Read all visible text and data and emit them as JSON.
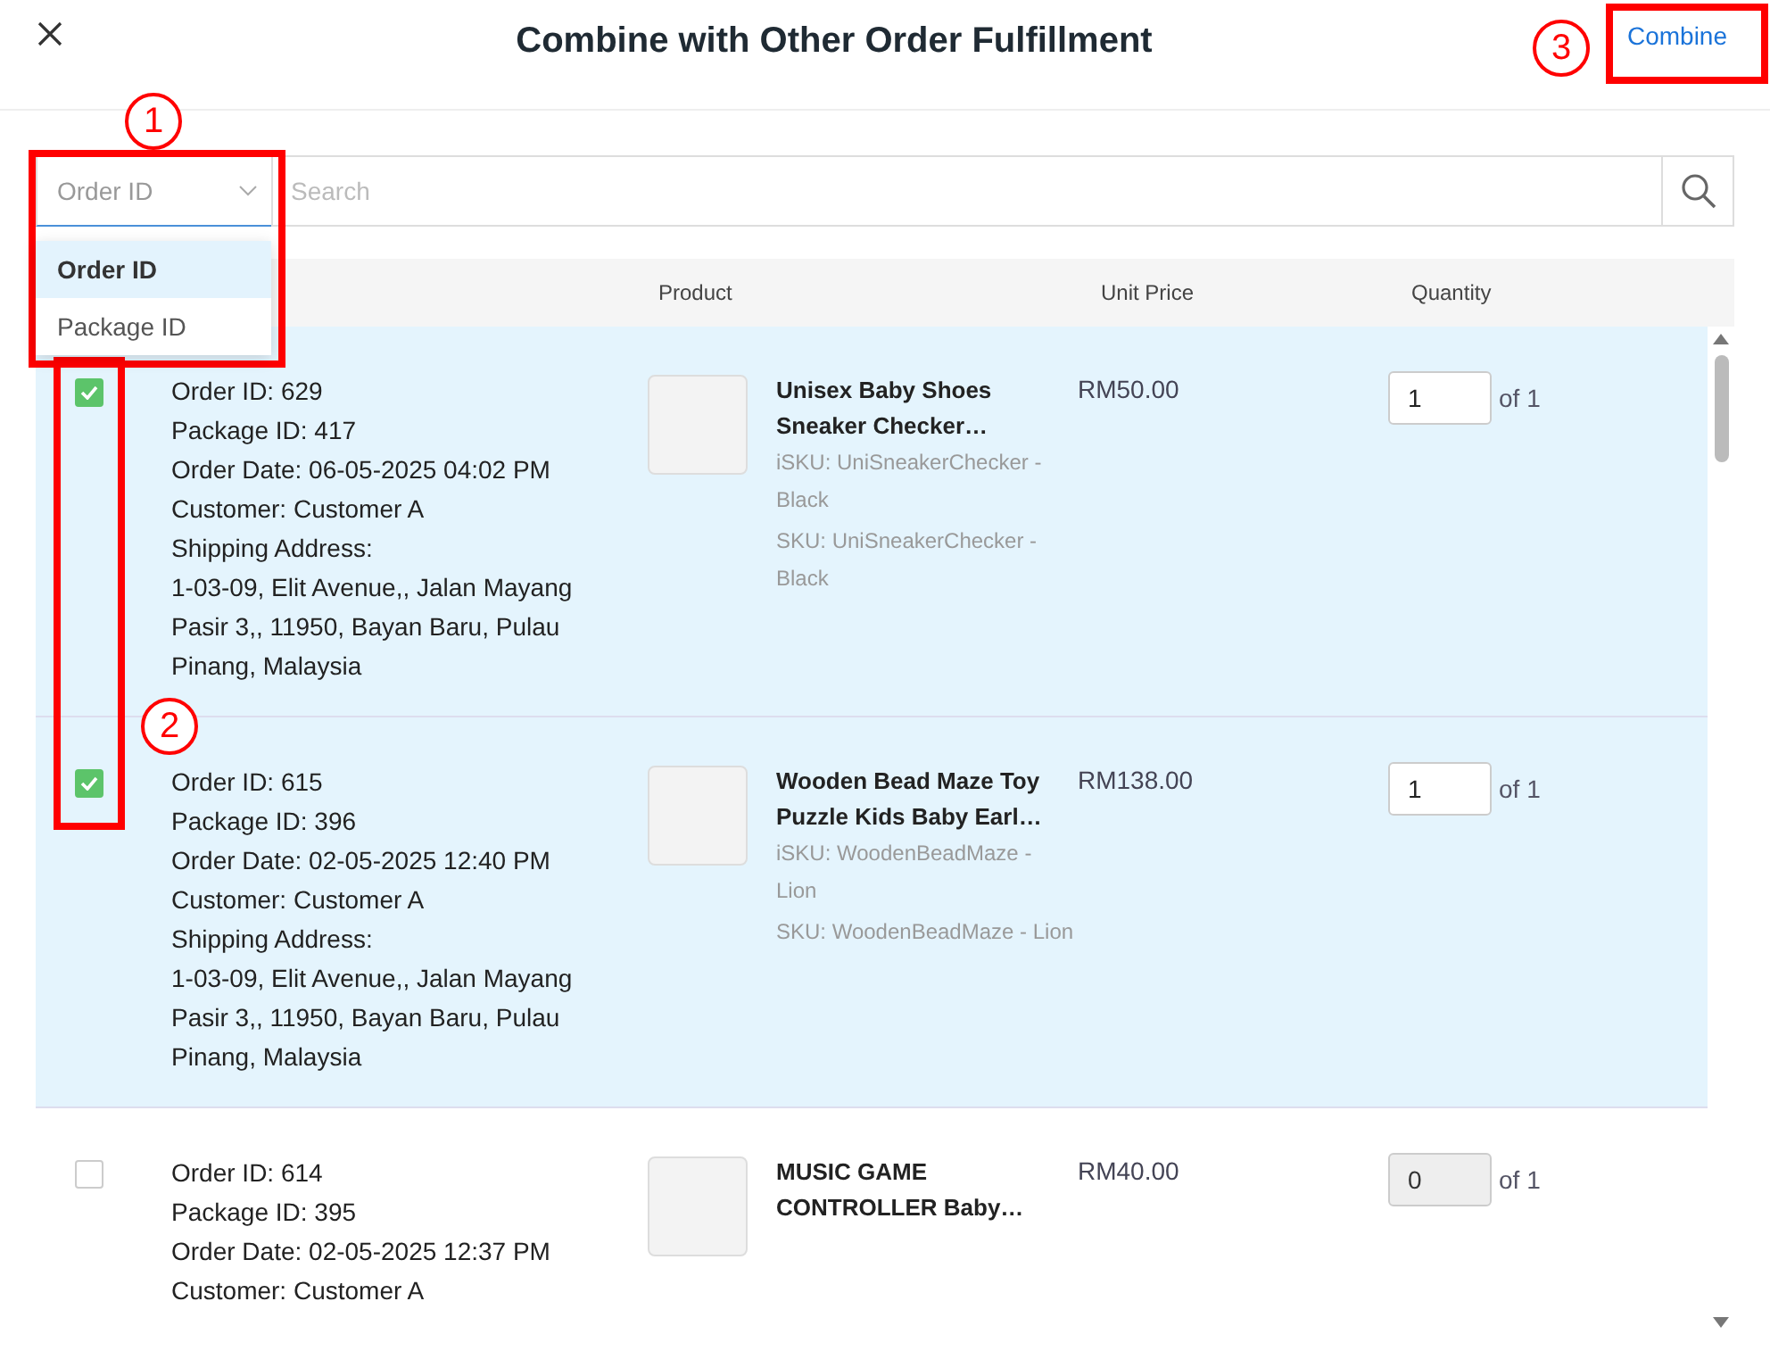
{
  "dialog": {
    "title": "Combine with Other Order Fulfillment",
    "primary_button": "Combine"
  },
  "search": {
    "filter": {
      "value": "Order ID",
      "expanded": true,
      "options": [
        {
          "label": "Order ID",
          "selected": true
        },
        {
          "label": "Package ID",
          "selected": false
        }
      ]
    },
    "placeholder": "Search"
  },
  "table": {
    "columns": [
      "Product",
      "Unit Price",
      "Quantity"
    ],
    "rows": [
      {
        "checked": true,
        "details": [
          "Order ID: 629",
          "Package ID: 417",
          "Order Date: 06-05-2025 04:02 PM",
          "Customer: Customer A",
          "Shipping Address:",
          "1-03-09, Elit Avenue,, Jalan Mayang Pasir 3,, 11950, Bayan Baru, Pulau Pinang, Malaysia"
        ],
        "product": {
          "name": "Unisex Baby Shoes Sneaker Checker…",
          "skus": [
            "iSKU: UniSneakerChecker - Black",
            "SKU: UniSneakerChecker - Black"
          ]
        },
        "unit_price": "RM50.00",
        "quantity": "1",
        "quantity_max": "of 1"
      },
      {
        "checked": true,
        "details": [
          "Order ID: 615",
          "Package ID: 396",
          "Order Date: 02-05-2025 12:40 PM",
          "Customer: Customer A",
          "Shipping Address:",
          "1-03-09, Elit Avenue,, Jalan Mayang Pasir 3,, 11950, Bayan Baru, Pulau Pinang, Malaysia"
        ],
        "product": {
          "name": "Wooden Bead Maze Toy Puzzle Kids Baby Earl…",
          "skus": [
            "iSKU: WoodenBeadMaze - Lion",
            "SKU: WoodenBeadMaze - Lion"
          ]
        },
        "unit_price": "RM138.00",
        "quantity": "1",
        "quantity_max": "of 1"
      },
      {
        "checked": false,
        "details": [
          "Order ID: 614",
          "Package ID: 395",
          "Order Date: 02-05-2025 12:37 PM",
          "Customer: Customer A"
        ],
        "product": {
          "name": "MUSIC GAME CONTROLLER Baby…"
        },
        "unit_price": "RM40.00",
        "quantity": "0",
        "quantity_max": "of 1"
      }
    ]
  },
  "annotations": [
    {
      "label": "1"
    },
    {
      "label": "2"
    },
    {
      "label": "3"
    }
  ]
}
